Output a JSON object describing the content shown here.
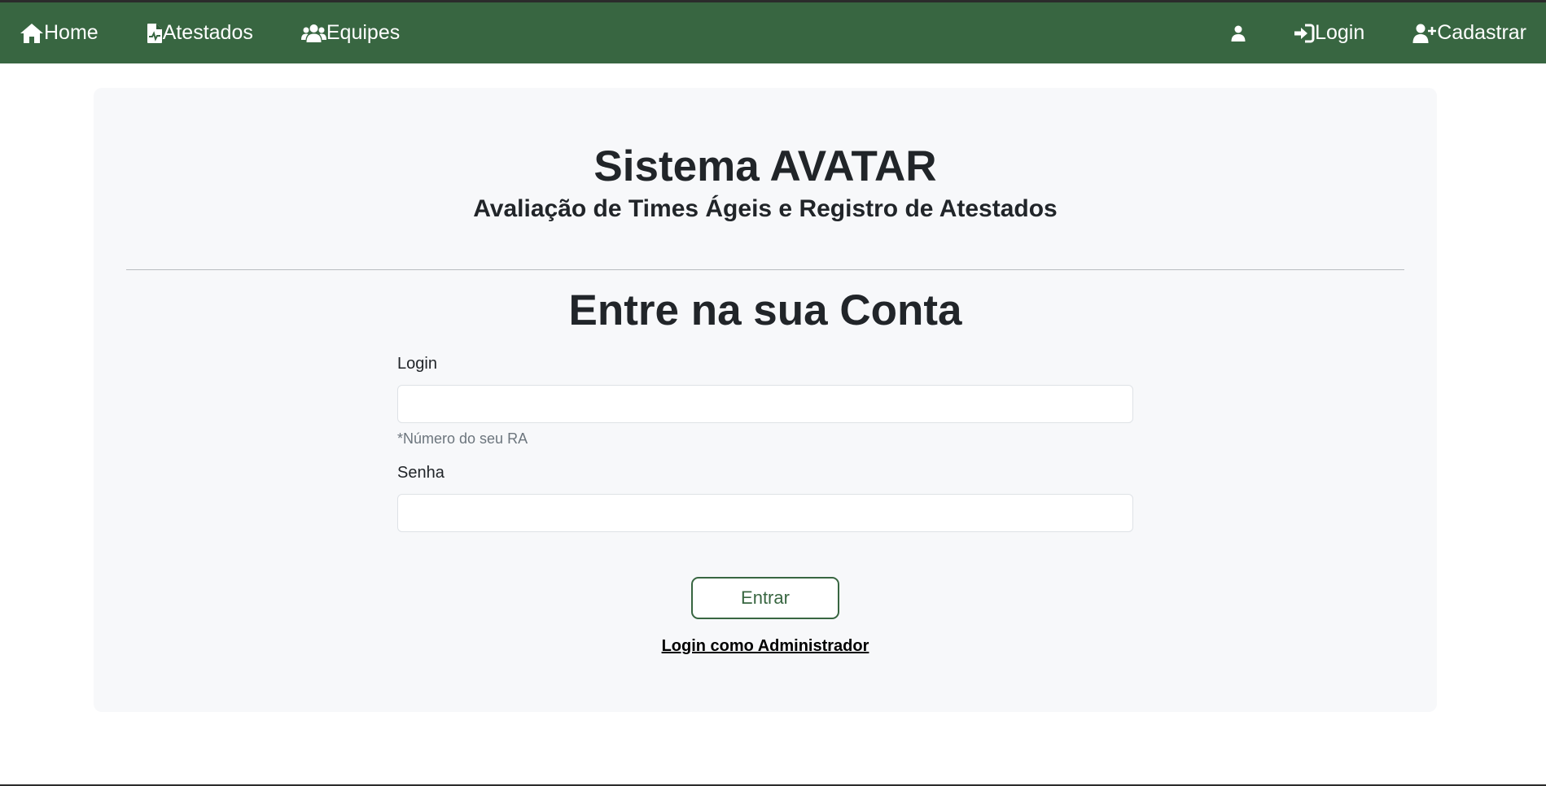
{
  "nav": {
    "home_label": "Home",
    "atestados_label": "Atestados",
    "equipes_label": "Equipes",
    "login_label": "Login",
    "cadastrar_label": "Cadastrar",
    "icons": {
      "home": "home-icon",
      "atestados": "file-medical-icon",
      "equipes": "users-icon",
      "profile": "user-icon",
      "login": "sign-in-icon",
      "cadastrar": "user-plus-icon"
    }
  },
  "header": {
    "title": "Sistema AVATAR",
    "subtitle": "Avaliação de Times Ágeis e Registro de Atestados"
  },
  "form": {
    "title": "Entre na sua Conta",
    "login_label": "Login",
    "login_value": "",
    "login_help": "*Número do seu RA",
    "senha_label": "Senha",
    "senha_value": "",
    "submit_label": "Entrar",
    "admin_link": "Login como Administrador"
  },
  "colors": {
    "navbar": "#386641",
    "card": "#f7f8fa",
    "accent": "#386641"
  }
}
